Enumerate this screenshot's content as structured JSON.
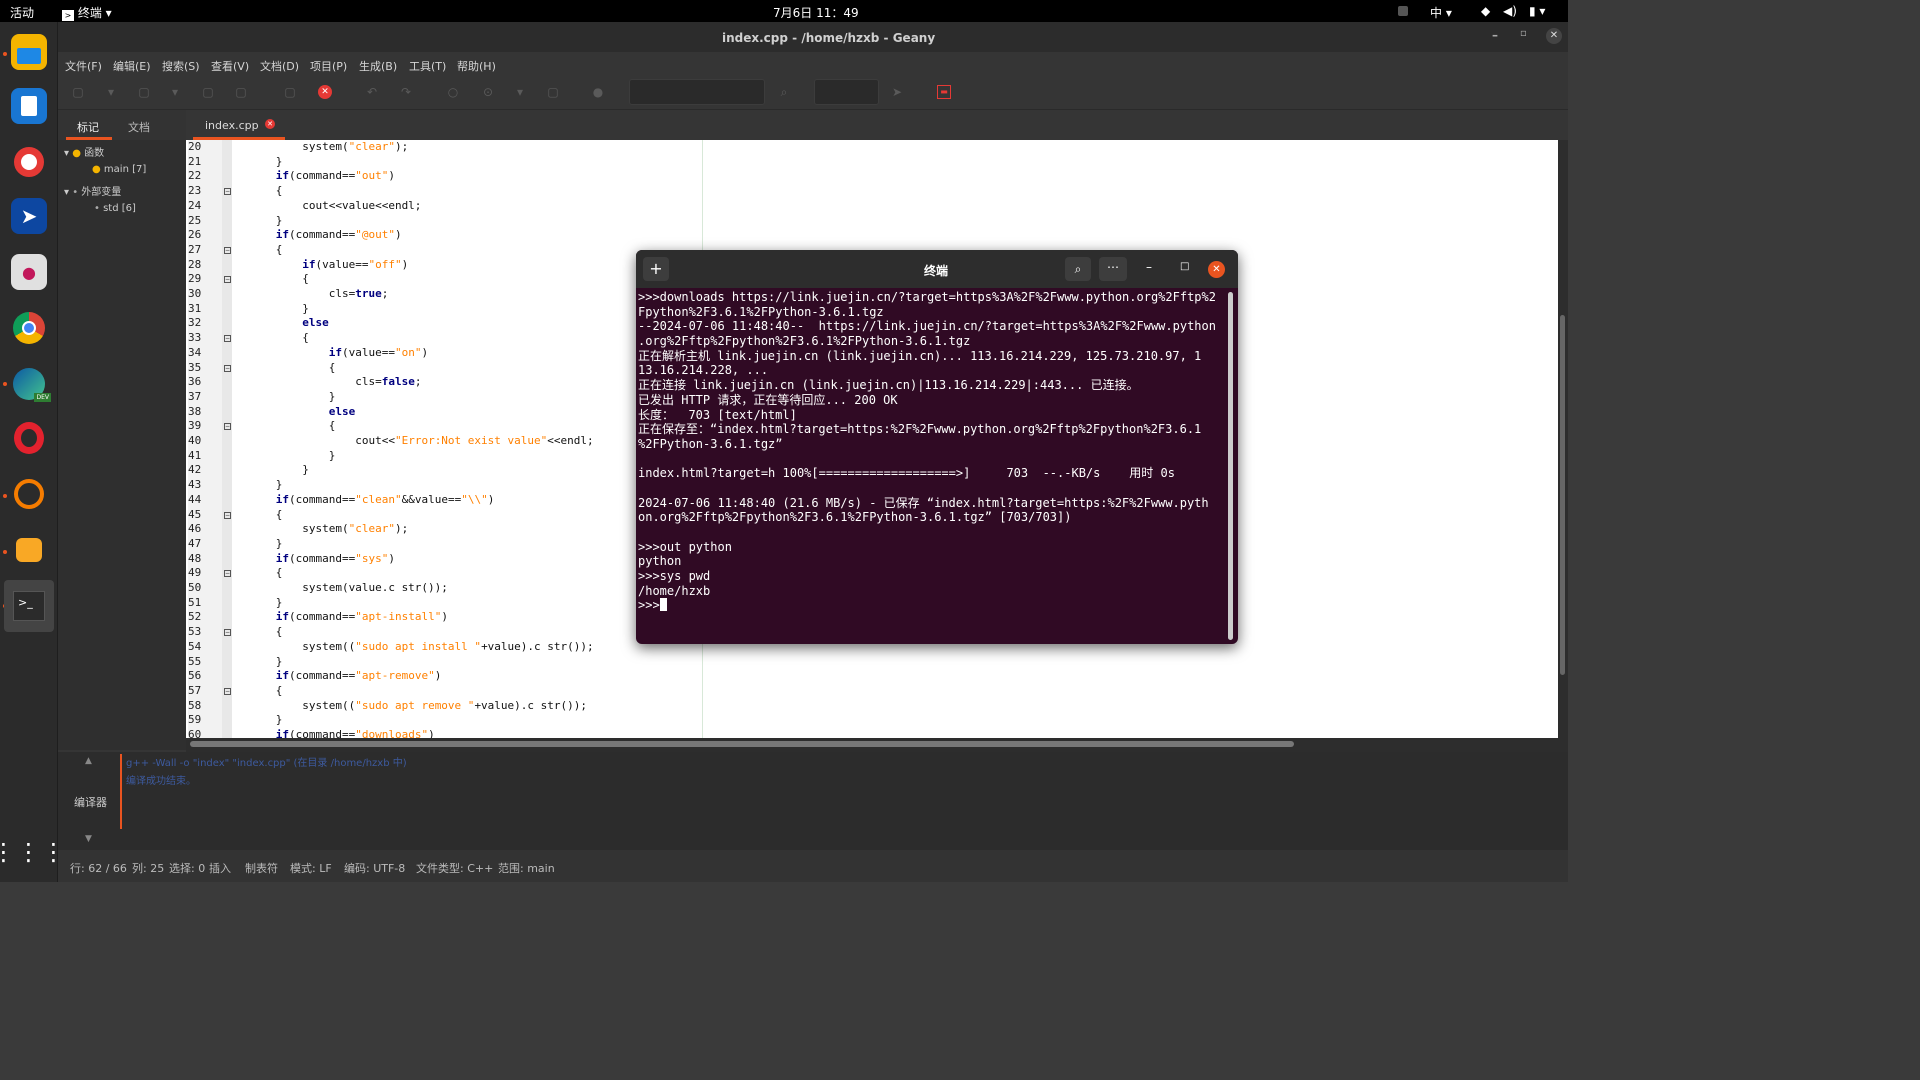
{
  "topbar": {
    "activities": "活动",
    "app": "终端",
    "clock": "7月6日  11：49",
    "ime": "中"
  },
  "window": {
    "title": "index.cpp - /home/hzxb - Geany"
  },
  "menu": [
    "文件(F)",
    "编辑(E)",
    "搜索(S)",
    "查看(V)",
    "文档(D)",
    "项目(P)",
    "生成(B)",
    "工具(T)",
    "帮助(H)"
  ],
  "sidebar": {
    "tab1": "标记",
    "tab2": "文档",
    "func": "函数",
    "main": "main [7]",
    "ext": "外部变量",
    "std": "std [6]"
  },
  "editor": {
    "tab": "index.cpp",
    "lines": [
      {
        "n": "20",
        "segs": [
          [
            "          system(",
            ""
          ],
          [
            "\"clear\"",
            "st"
          ],
          [
            ");",
            ""
          ]
        ]
      },
      {
        "n": "21",
        "segs": [
          [
            "      }",
            ""
          ]
        ]
      },
      {
        "n": "22",
        "segs": [
          [
            "      ",
            ""
          ],
          [
            "if",
            "kw"
          ],
          [
            "(command==",
            ""
          ],
          [
            "\"out\"",
            "st"
          ],
          [
            ")",
            ""
          ]
        ]
      },
      {
        "n": "23",
        "fold": true,
        "segs": [
          [
            "      {",
            ""
          ]
        ]
      },
      {
        "n": "24",
        "segs": [
          [
            "          cout<<value<<endl;",
            ""
          ]
        ]
      },
      {
        "n": "25",
        "segs": [
          [
            "      }",
            ""
          ]
        ]
      },
      {
        "n": "26",
        "segs": [
          [
            "      ",
            ""
          ],
          [
            "if",
            "kw"
          ],
          [
            "(command==",
            ""
          ],
          [
            "\"@out\"",
            "st"
          ],
          [
            ")",
            ""
          ]
        ]
      },
      {
        "n": "27",
        "fold": true,
        "segs": [
          [
            "      {",
            ""
          ]
        ]
      },
      {
        "n": "28",
        "segs": [
          [
            "          ",
            ""
          ],
          [
            "if",
            "kw"
          ],
          [
            "(value==",
            ""
          ],
          [
            "\"off\"",
            "st"
          ],
          [
            ")",
            ""
          ]
        ]
      },
      {
        "n": "29",
        "fold": true,
        "segs": [
          [
            "          {",
            ""
          ]
        ]
      },
      {
        "n": "30",
        "segs": [
          [
            "              cls=",
            ""
          ],
          [
            "true",
            "kw"
          ],
          [
            ";",
            ""
          ]
        ]
      },
      {
        "n": "31",
        "segs": [
          [
            "          }",
            ""
          ]
        ]
      },
      {
        "n": "32",
        "segs": [
          [
            "          ",
            ""
          ],
          [
            "else",
            "kw"
          ]
        ]
      },
      {
        "n": "33",
        "fold": true,
        "segs": [
          [
            "          {",
            ""
          ]
        ]
      },
      {
        "n": "34",
        "segs": [
          [
            "              ",
            ""
          ],
          [
            "if",
            "kw"
          ],
          [
            "(value==",
            ""
          ],
          [
            "\"on\"",
            "st"
          ],
          [
            ")",
            ""
          ]
        ]
      },
      {
        "n": "35",
        "fold": true,
        "segs": [
          [
            "              {",
            ""
          ]
        ]
      },
      {
        "n": "36",
        "segs": [
          [
            "                  cls=",
            ""
          ],
          [
            "false",
            "kw"
          ],
          [
            ";",
            ""
          ]
        ]
      },
      {
        "n": "37",
        "segs": [
          [
            "              }",
            ""
          ]
        ]
      },
      {
        "n": "38",
        "segs": [
          [
            "              ",
            ""
          ],
          [
            "else",
            "kw"
          ]
        ]
      },
      {
        "n": "39",
        "fold": true,
        "segs": [
          [
            "              {",
            ""
          ]
        ]
      },
      {
        "n": "40",
        "segs": [
          [
            "                  cout<<",
            ""
          ],
          [
            "\"Error:Not exist value\"",
            "st"
          ],
          [
            "<<endl;",
            ""
          ]
        ]
      },
      {
        "n": "41",
        "segs": [
          [
            "              }",
            ""
          ]
        ]
      },
      {
        "n": "42",
        "segs": [
          [
            "          }",
            ""
          ]
        ]
      },
      {
        "n": "43",
        "segs": [
          [
            "      }",
            ""
          ]
        ]
      },
      {
        "n": "44",
        "segs": [
          [
            "      ",
            ""
          ],
          [
            "if",
            "kw"
          ],
          [
            "(command==",
            ""
          ],
          [
            "\"clean\"",
            "st"
          ],
          [
            "&&value==",
            ""
          ],
          [
            "\"\\\\\"",
            "st"
          ],
          [
            ")",
            ""
          ]
        ]
      },
      {
        "n": "45",
        "fold": true,
        "segs": [
          [
            "      {",
            ""
          ]
        ]
      },
      {
        "n": "46",
        "segs": [
          [
            "          system(",
            ""
          ],
          [
            "\"clear\"",
            "st"
          ],
          [
            ");",
            ""
          ]
        ]
      },
      {
        "n": "47",
        "segs": [
          [
            "      }",
            ""
          ]
        ]
      },
      {
        "n": "48",
        "segs": [
          [
            "      ",
            ""
          ],
          [
            "if",
            "kw"
          ],
          [
            "(command==",
            ""
          ],
          [
            "\"sys\"",
            "st"
          ],
          [
            ")",
            ""
          ]
        ]
      },
      {
        "n": "49",
        "fold": true,
        "segs": [
          [
            "      {",
            ""
          ]
        ]
      },
      {
        "n": "50",
        "segs": [
          [
            "          system(value.c str());",
            ""
          ]
        ]
      },
      {
        "n": "51",
        "segs": [
          [
            "      }",
            ""
          ]
        ]
      },
      {
        "n": "52",
        "segs": [
          [
            "      ",
            ""
          ],
          [
            "if",
            "kw"
          ],
          [
            "(command==",
            ""
          ],
          [
            "\"apt-install\"",
            "st"
          ],
          [
            ")",
            ""
          ]
        ]
      },
      {
        "n": "53",
        "fold": true,
        "segs": [
          [
            "      {",
            ""
          ]
        ]
      },
      {
        "n": "54",
        "segs": [
          [
            "          system((",
            ""
          ],
          [
            "\"sudo apt install \"",
            "st"
          ],
          [
            "+value).c str());",
            ""
          ]
        ]
      },
      {
        "n": "55",
        "segs": [
          [
            "      }",
            ""
          ]
        ]
      },
      {
        "n": "56",
        "segs": [
          [
            "      ",
            ""
          ],
          [
            "if",
            "kw"
          ],
          [
            "(command==",
            ""
          ],
          [
            "\"apt-remove\"",
            "st"
          ],
          [
            ")",
            ""
          ]
        ]
      },
      {
        "n": "57",
        "fold": true,
        "segs": [
          [
            "      {",
            ""
          ]
        ]
      },
      {
        "n": "58",
        "segs": [
          [
            "          system((",
            ""
          ],
          [
            "\"sudo apt remove \"",
            "st"
          ],
          [
            "+value).c str());",
            ""
          ]
        ]
      },
      {
        "n": "59",
        "segs": [
          [
            "      }",
            ""
          ]
        ]
      },
      {
        "n": "60",
        "segs": [
          [
            "      ",
            ""
          ],
          [
            "if",
            "kw"
          ],
          [
            "(command==",
            ""
          ],
          [
            "\"downloads\"",
            "st"
          ],
          [
            ")",
            ""
          ]
        ]
      }
    ]
  },
  "compiler": {
    "label": "编译器",
    "line1": "g++ -Wall -o \"index\" \"index.cpp\" (在目录 /home/hzxb 中)",
    "line2": "编译成功结束。"
  },
  "status": {
    "row": "行: 62 / 66",
    "col": "列: 25",
    "sel": "选择: 0",
    "ins": "插入",
    "tab": "制表符",
    "mode": "模式: LF",
    "enc": "编码: UTF-8",
    "ftype": "文件类型: C++",
    "scope": "范围: main"
  },
  "terminal": {
    "title": "终端",
    "lines": [
      ">>>downloads https://link.juejin.cn/?target=https%3A%2F%2Fwww.python.org%2Fftp%2",
      "Fpython%2F3.6.1%2FPython-3.6.1.tgz",
      "--2024-07-06 11:48:40--  https://link.juejin.cn/?target=https%3A%2F%2Fwww.python",
      ".org%2Fftp%2Fpython%2F3.6.1%2FPython-3.6.1.tgz",
      "正在解析主机 link.juejin.cn (link.juejin.cn)... 113.16.214.229, 125.73.210.97, 1",
      "13.16.214.228, ...",
      "正在连接 link.juejin.cn (link.juejin.cn)|113.16.214.229|:443... 已连接。",
      "已发出 HTTP 请求，正在等待回应... 200 OK",
      "长度：  703 [text/html]",
      "正在保存至：“index.html?target=https:%2F%2Fwww.python.org%2Fftp%2Fpython%2F3.6.1",
      "%2FPython-3.6.1.tgz”",
      "",
      "index.html?target=h 100%[===================>]     703  --.-KB/s    用时 0s",
      "",
      "2024-07-06 11:48:40 (21.6 MB/s) - 已保存 “index.html?target=https:%2F%2Fwww.pyth",
      "on.org%2Fftp%2Fpython%2F3.6.1%2FPython-3.6.1.tgz” [703/703])",
      "",
      ">>>out python",
      "python",
      ">>>sys pwd",
      "/home/hzxb",
      ">>>"
    ]
  },
  "colors": {
    "accent": "#e95420",
    "terminal_bg": "#300a24"
  },
  "dock_icons": [
    "files-icon",
    "writer-icon",
    "help-icon",
    "remmina-icon",
    "software-icon",
    "chrome-icon",
    "edge-icon",
    "opera-icon",
    "update-icon",
    "geany-icon",
    "terminal-icon",
    "apps-grid-icon"
  ]
}
